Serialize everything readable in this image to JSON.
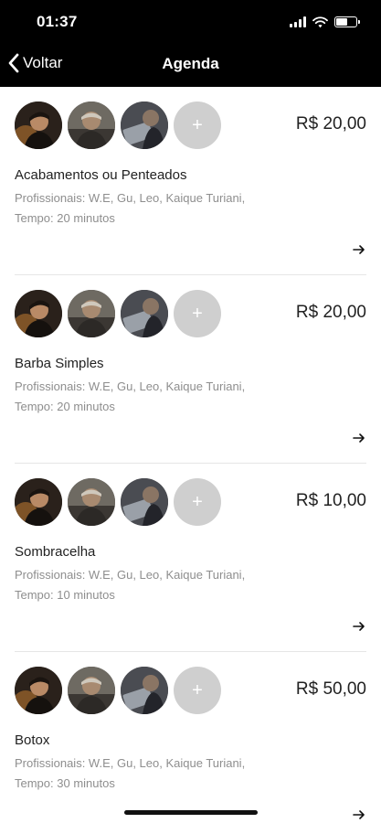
{
  "status_bar": {
    "time": "01:37",
    "battery_level": 0.55
  },
  "nav": {
    "back_label": "Voltar",
    "title": "Agenda"
  },
  "add_symbol": "+",
  "services": [
    {
      "name": "Acabamentos ou Penteados",
      "price": "R$ 20,00",
      "professionals": "Profissionais: W.E, Gu, Leo, Kaique Turiani,",
      "time": "Tempo: 20 minutos"
    },
    {
      "name": "Barba Simples",
      "price": "R$ 20,00",
      "professionals": "Profissionais: W.E, Gu, Leo, Kaique Turiani,",
      "time": "Tempo: 20 minutos"
    },
    {
      "name": "Sombracelha",
      "price": "R$ 10,00",
      "professionals": "Profissionais: W.E, Gu, Leo, Kaique Turiani,",
      "time": "Tempo: 10 minutos"
    },
    {
      "name": "Botox",
      "price": "R$ 50,00",
      "professionals": "Profissionais: W.E, Gu, Leo, Kaique Turiani,",
      "time": "Tempo: 30 minutos"
    }
  ],
  "colors": {
    "header_bg": "#000000",
    "secondary_text": "#8e8e8e",
    "add_avatar": "#cfcfcf",
    "divider": "#e6e6e6"
  }
}
